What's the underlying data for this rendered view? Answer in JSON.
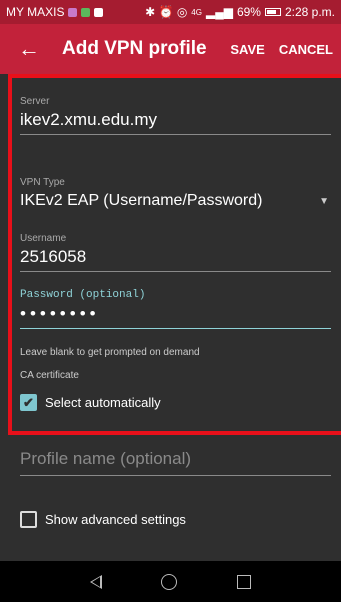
{
  "status_bar": {
    "carrier": "MY MAXIS",
    "icons": "✱ ⏰ ◎",
    "network": "4G",
    "signal": "▂▄▆",
    "battery": "69%",
    "time": "2:28 p.m.",
    "colors": {
      "mini1": "#c879c9",
      "mini2": "#5cb85c",
      "mini3": "#ffffff"
    }
  },
  "app_bar": {
    "back_icon": "←",
    "title": "Add VPN profile",
    "save": "SAVE",
    "cancel": "CANCEL"
  },
  "form": {
    "server_label": "Server",
    "server_value": "ikev2.xmu.edu.my",
    "vpn_type_label": "VPN Type",
    "vpn_type_value": "IKEv2 EAP (Username/Password)",
    "dropdown_arrow": "▼",
    "username_label": "Username",
    "username_value": "2516058",
    "password_label": "Password (optional)",
    "password_value": "••••••••",
    "password_hint": "Leave blank to get prompted on demand",
    "ca_label": "CA certificate",
    "ca_auto_label": "Select automatically",
    "ca_auto_checked": true,
    "check_glyph": "✔",
    "profile_name_placeholder": "Profile name (optional)",
    "advanced_label": "Show advanced settings",
    "advanced_checked": false
  },
  "colors": {
    "accent": "#c2223a",
    "highlight_border": "#e8101a",
    "checkbox": "#7fc6cf",
    "background": "#2f2f2f"
  }
}
